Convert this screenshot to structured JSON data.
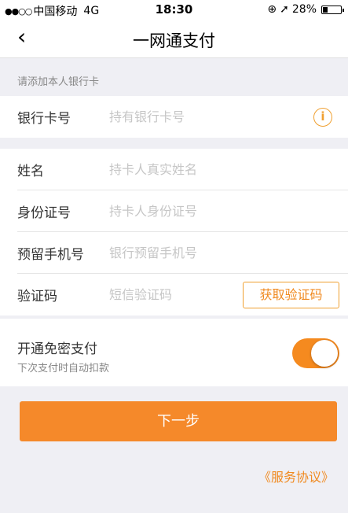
{
  "status_bar": {
    "signal": "●●○○",
    "carrier": "中国移动",
    "network": "4G",
    "time": "18:30",
    "lock_icon": "⊕",
    "location_icon": "➚",
    "battery_percent": "28%",
    "battery_level": 0.28
  },
  "nav": {
    "back_icon": "‹",
    "title": "一网通支付"
  },
  "hint": "请添加本人银行卡",
  "card": {
    "label": "银行卡号",
    "placeholder": "持有银行卡号",
    "info_icon": "i"
  },
  "form": {
    "name_label": "姓名",
    "name_placeholder": "持卡人真实姓名",
    "id_label": "身份证号",
    "id_placeholder": "持卡人身份证号",
    "phone_label": "预留手机号",
    "phone_placeholder": "银行预留手机号",
    "code_label": "验证码",
    "code_placeholder": "短信验证码",
    "code_button": "获取验证码"
  },
  "password_free": {
    "title": "开通免密支付",
    "subtitle": "下次支付时自动扣款",
    "enabled": true
  },
  "next_button": "下一步",
  "agreement_link": "《服务协议》",
  "colors": {
    "accent": "#f5892a",
    "background": "#efeff4"
  }
}
